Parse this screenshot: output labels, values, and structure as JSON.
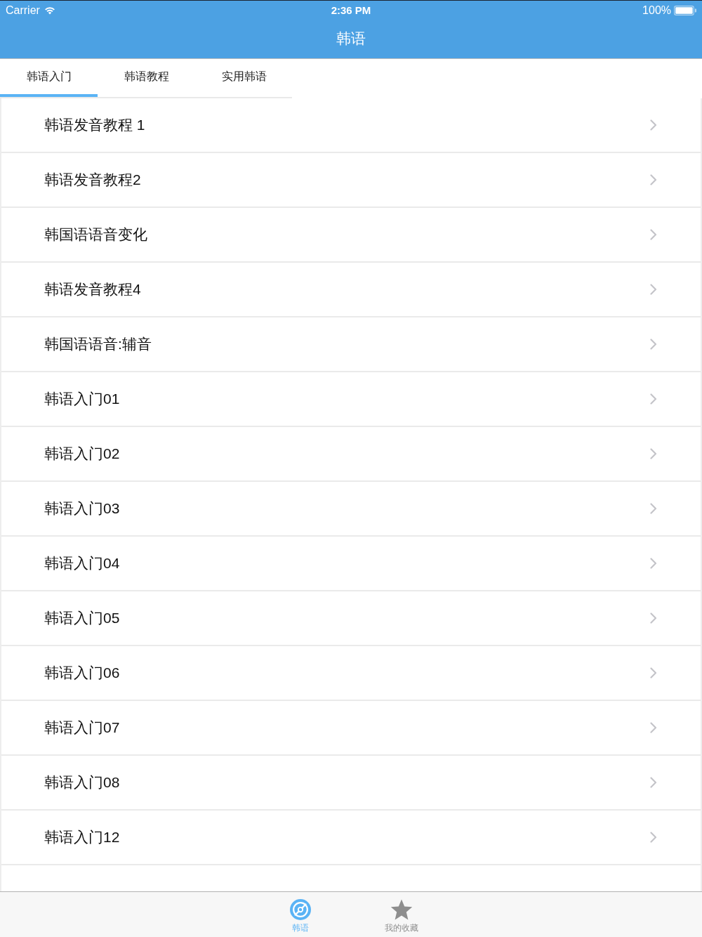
{
  "status_bar": {
    "carrier": "Carrier",
    "time": "2:36 PM",
    "battery": "100%"
  },
  "nav_bar": {
    "title": "韩语"
  },
  "tabs": [
    {
      "label": "韩语入门",
      "selected": true
    },
    {
      "label": "韩语教程",
      "selected": false
    },
    {
      "label": "实用韩语",
      "selected": false
    }
  ],
  "list": {
    "rows": [
      {
        "label": "韩语发音教程 1"
      },
      {
        "label": "韩语发音教程2"
      },
      {
        "label": "韩国语语音变化"
      },
      {
        "label": "韩语发音教程4"
      },
      {
        "label": "韩国语语音:辅音"
      },
      {
        "label": "韩语入门01"
      },
      {
        "label": "韩语入门02"
      },
      {
        "label": "韩语入门03"
      },
      {
        "label": "韩语入门04"
      },
      {
        "label": "韩语入门05"
      },
      {
        "label": "韩语入门06"
      },
      {
        "label": "韩语入门07"
      },
      {
        "label": "韩语入门08"
      },
      {
        "label": "韩语入门12"
      }
    ]
  },
  "tab_bar": {
    "items": [
      {
        "label": "韩语",
        "selected": true,
        "kind": "disc"
      },
      {
        "label": "我的收藏",
        "selected": false,
        "kind": "star"
      }
    ]
  }
}
